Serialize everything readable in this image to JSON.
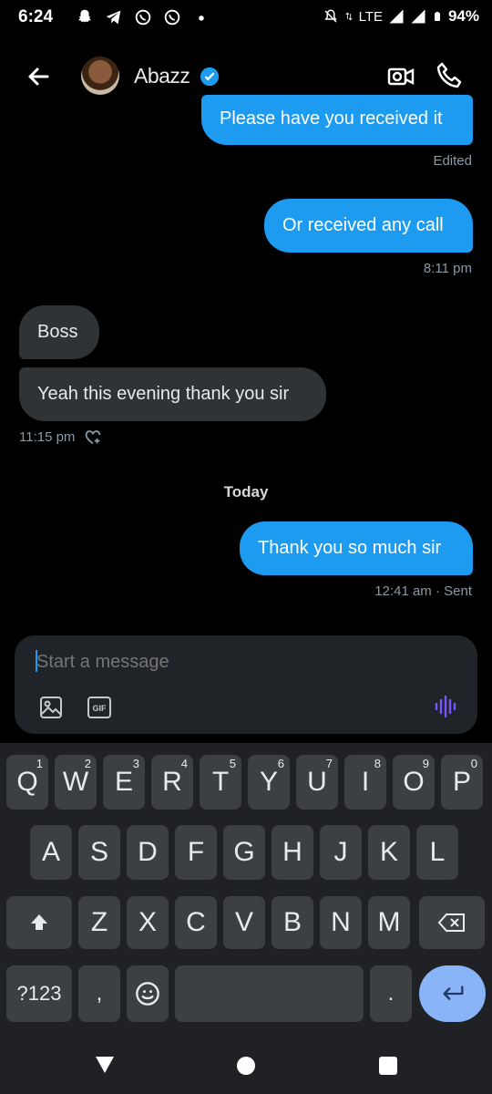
{
  "status_bar": {
    "time": "6:24",
    "network": "LTE",
    "battery": "94%"
  },
  "header": {
    "contact_name": "Abazz"
  },
  "messages": [
    {
      "direction": "out",
      "text": "Please have you received it",
      "meta": "Edited"
    },
    {
      "direction": "out",
      "text": "Or received any call",
      "meta": "8:11 pm"
    },
    {
      "direction": "in",
      "text": "Boss"
    },
    {
      "direction": "in",
      "text": "Yeah this evening thank you sir",
      "meta": "11:15 pm"
    },
    {
      "direction": "out",
      "text": "Thank you so much sir",
      "meta": "12:41 am · Sent"
    }
  ],
  "date_separator": "Today",
  "composer": {
    "placeholder": "Start a message"
  },
  "keyboard": {
    "row1": [
      {
        "label": "Q",
        "hint": "1"
      },
      {
        "label": "W",
        "hint": "2"
      },
      {
        "label": "E",
        "hint": "3"
      },
      {
        "label": "R",
        "hint": "4"
      },
      {
        "label": "T",
        "hint": "5"
      },
      {
        "label": "Y",
        "hint": "6"
      },
      {
        "label": "U",
        "hint": "7"
      },
      {
        "label": "I",
        "hint": "8"
      },
      {
        "label": "O",
        "hint": "9"
      },
      {
        "label": "P",
        "hint": "0"
      }
    ],
    "row2": [
      "A",
      "S",
      "D",
      "F",
      "G",
      "H",
      "J",
      "K",
      "L"
    ],
    "row3": [
      "Z",
      "X",
      "C",
      "V",
      "B",
      "N",
      "M"
    ],
    "symbols_label": "?123",
    "comma_label": ",",
    "period_label": "."
  },
  "colors": {
    "accent": "#1d9bf0",
    "incoming_bubble": "#2f3336",
    "voice_icon": "#7856ff",
    "enter_key": "#8ab4f8"
  }
}
